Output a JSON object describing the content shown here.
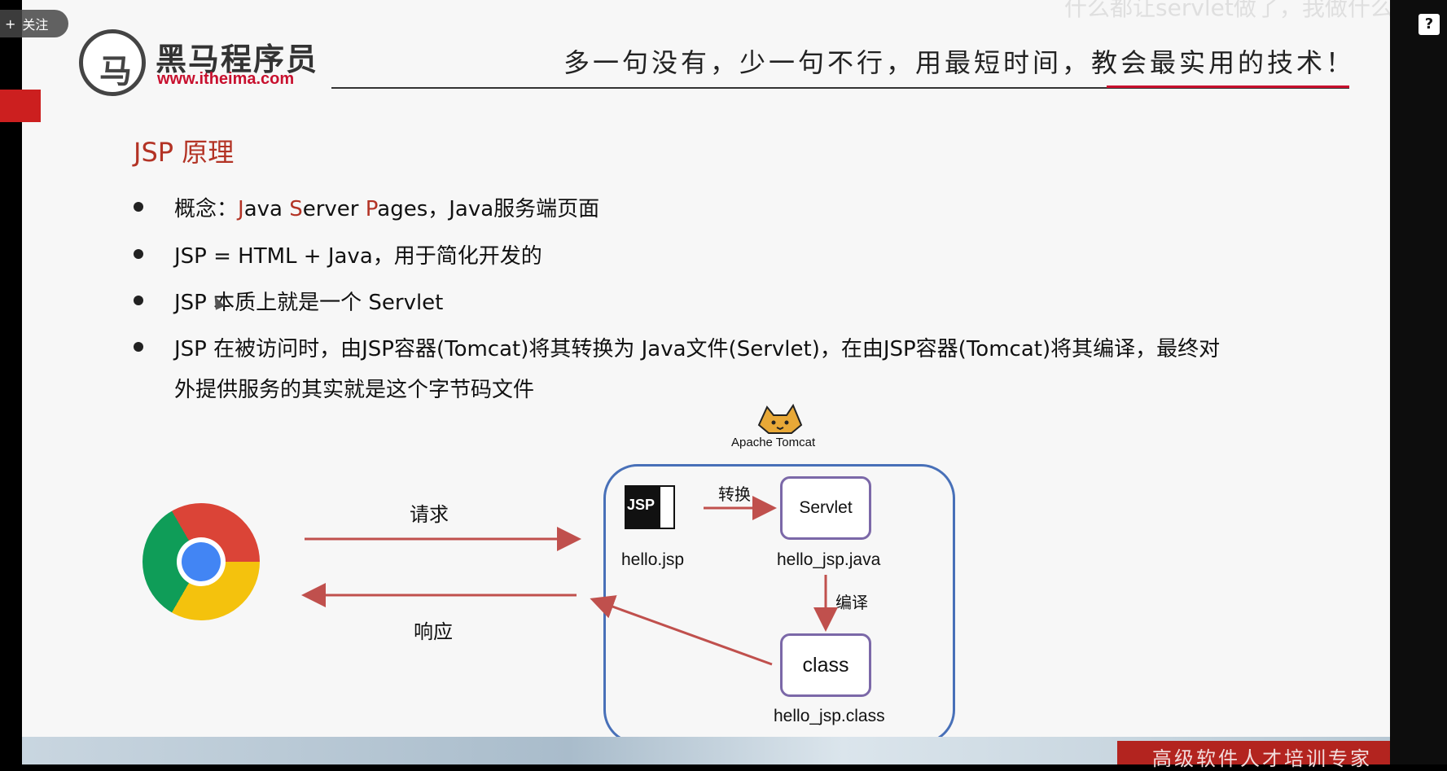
{
  "overlay": {
    "follow_label": "关注",
    "follow_plus": "+",
    "help_label": "?",
    "faint_caption": "什么都让servlet做了，我做什么"
  },
  "logo": {
    "name": "黑马程序员",
    "url": "www.itheima.com"
  },
  "slogan": "多一句没有，少一句不行，用最短时间，教会最实用的技术！",
  "title": "JSP 原理",
  "bullets": {
    "b1_prefix": "概念：",
    "b1_j": "J",
    "b1_ava": "ava ",
    "b1_s": "S",
    "b1_erver": "erver ",
    "b1_p": "P",
    "b1_ages": "ages，Java服务端页面",
    "b2": "JSP = HTML + Java，用于简化开发的",
    "b3": "JSP 本质上就是一个 Servlet",
    "b4_line1": "JSP 在被访问时，由JSP容器(Tomcat)将其转换为 Java文件(Servlet)，在由JSP容器(Tomcat)将其编译，最终对",
    "b4_line2": "外提供服务的其实就是这个字节码文件"
  },
  "diagram": {
    "tomcat_label": "Apache Tomcat",
    "request_label": "请求",
    "response_label": "响应",
    "convert_label": "转换",
    "compile_label": "编译",
    "jsp_icon_text": "JSP",
    "jsp_file": "hello.jsp",
    "servlet_box": "Servlet",
    "servlet_file": "hello_jsp.java",
    "class_box": "class",
    "class_file": "hello_jsp.class"
  },
  "footer": {
    "tagline": "高级软件人才培训专家"
  },
  "colors": {
    "accent_red": "#b33325",
    "container_blue": "#4870b8",
    "box_purple": "#7b68a8",
    "arrow_red": "#c0504d"
  }
}
